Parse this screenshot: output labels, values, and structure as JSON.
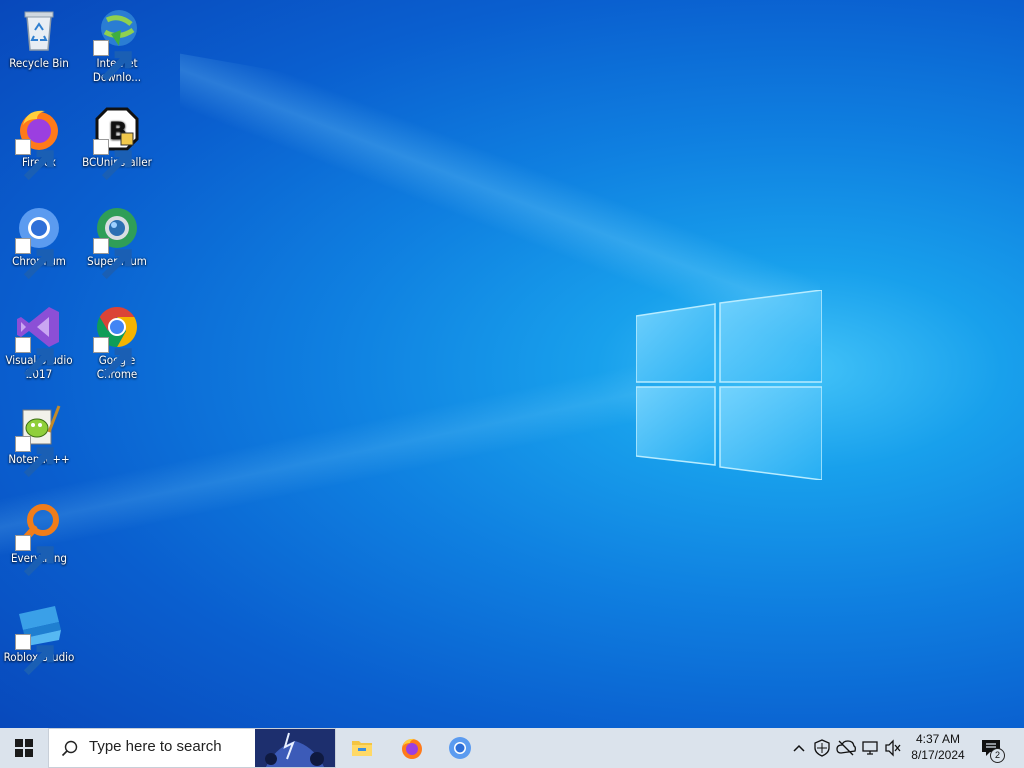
{
  "desktop": {
    "icons": [
      {
        "label": "Recycle Bin",
        "icon": "recycle-bin-icon"
      },
      {
        "label": "Internet Downlo...",
        "icon": "internet-download-manager-icon"
      },
      {
        "label": "Firefox",
        "icon": "firefox-icon"
      },
      {
        "label": "BCUninstaller",
        "icon": "bcuninstaller-icon"
      },
      {
        "label": "Chromium",
        "icon": "chromium-icon"
      },
      {
        "label": "Supermium",
        "icon": "supermium-icon"
      },
      {
        "label": "Visual Studio 2017",
        "icon": "visual-studio-icon"
      },
      {
        "label": "Google Chrome",
        "icon": "google-chrome-icon"
      },
      {
        "label": "Notepad++",
        "icon": "notepad-plus-plus-icon"
      },
      {
        "label": "Everything",
        "icon": "everything-search-icon"
      },
      {
        "label": "Roblox Studio",
        "icon": "roblox-studio-icon"
      }
    ]
  },
  "taskbar": {
    "search_placeholder": "Type here to search",
    "pinned": [
      {
        "name": "File Explorer",
        "icon": "file-explorer-icon"
      },
      {
        "name": "Firefox",
        "icon": "firefox-icon"
      },
      {
        "name": "Chromium",
        "icon": "chromium-icon"
      }
    ],
    "tray": {
      "icons": [
        "chevron-up-icon",
        "security-shield-icon",
        "cloud-offline-icon",
        "network-icon",
        "volume-muted-icon"
      ],
      "time": "4:37 AM",
      "date": "8/17/2024",
      "notification_count": "2"
    }
  },
  "colors": {
    "wallpaper_accent": "#1aa3ee",
    "taskbar_bg": "#dbe3ec"
  }
}
